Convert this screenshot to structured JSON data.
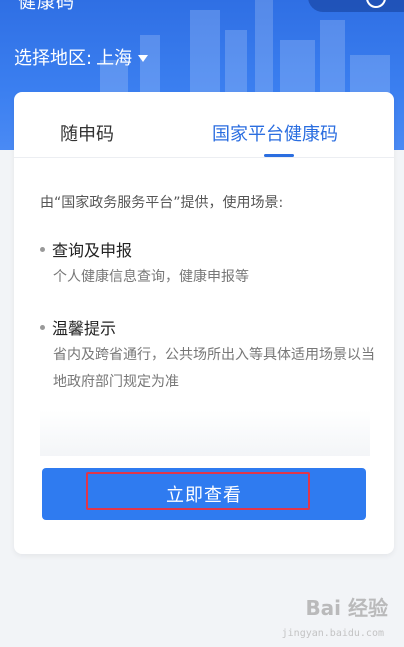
{
  "header": {
    "title": "健康码",
    "region_label": "选择地区:",
    "region_value": "上海"
  },
  "tabs": [
    {
      "label": "随申码",
      "active": false
    },
    {
      "label": "国家平台健康码",
      "active": true
    }
  ],
  "card": {
    "intro": "由“国家政务服务平台”提供，使用场景:",
    "sections": [
      {
        "title": "查询及申报",
        "desc": "个人健康信息查询，健康申报等"
      },
      {
        "title": "温馨提示",
        "desc": "省内及跨省通行，公共场所出入等具体适用场景以当地政府部门规定为准"
      }
    ],
    "button_label": "立即查看"
  },
  "watermark": {
    "text": "Bai 经验",
    "sub": "jingyan.baidu.com"
  },
  "colors": {
    "primary": "#2f7bf0",
    "accent_tab": "#2b6ee0",
    "highlight": "#e0364a"
  }
}
